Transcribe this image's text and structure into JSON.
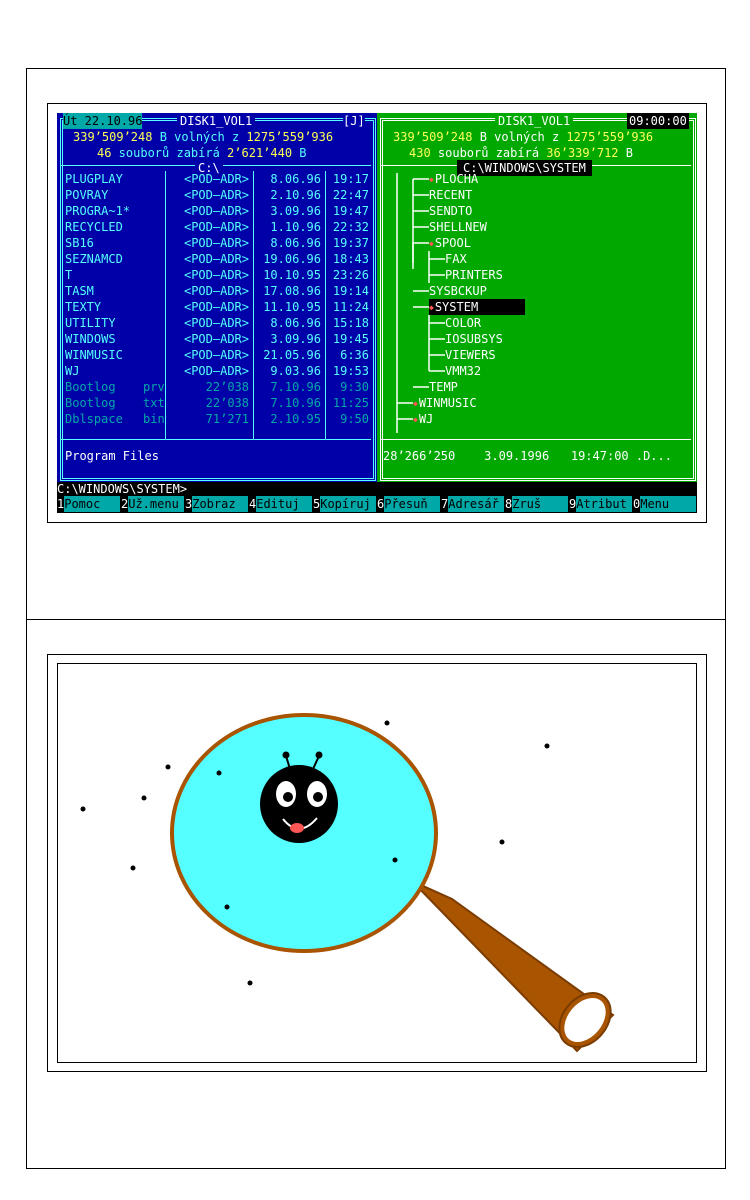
{
  "left": {
    "date": "Út 22.10.96",
    "volume": "DISK1_VOL1",
    "drive_tag": "[J]",
    "free_line": {
      "a": "339’509’248",
      "b": " B volných z ",
      "c": "1275’559’936"
    },
    "files_line": {
      "a": "46",
      "b": " souborů zabírá ",
      "c": "2’621’440",
      "d": " B"
    },
    "path": "C:\\",
    "rows": [
      {
        "name": "PLUGPLAY",
        "ext": "",
        "size": "<POD—ADR>",
        "date": "8.06.96",
        "time": "19:17"
      },
      {
        "name": "POVRAY",
        "ext": "",
        "size": "<POD—ADR>",
        "date": "2.10.96",
        "time": "22:47"
      },
      {
        "name": "PROGRA~1*",
        "ext": "",
        "size": "<POD—ADR>",
        "date": "3.09.96",
        "time": "19:47"
      },
      {
        "name": "RECYCLED",
        "ext": "",
        "size": "<POD—ADR>",
        "date": "1.10.96",
        "time": "22:32"
      },
      {
        "name": "SB16",
        "ext": "",
        "size": "<POD—ADR>",
        "date": "8.06.96",
        "time": "19:37"
      },
      {
        "name": "SEZNAMCD",
        "ext": "",
        "size": "<POD—ADR>",
        "date": "19.06.96",
        "time": "18:43"
      },
      {
        "name": "T",
        "ext": "",
        "size": "<POD—ADR>",
        "date": "10.10.95",
        "time": "23:26"
      },
      {
        "name": "TASM",
        "ext": "",
        "size": "<POD—ADR>",
        "date": "17.08.96",
        "time": "19:14"
      },
      {
        "name": "TEXTY",
        "ext": "",
        "size": "<POD—ADR>",
        "date": "11.10.95",
        "time": "11:24"
      },
      {
        "name": "UTILITY",
        "ext": "",
        "size": "<POD—ADR>",
        "date": "8.06.96",
        "time": "15:18"
      },
      {
        "name": "WINDOWS",
        "ext": "",
        "size": "<POD—ADR>",
        "date": "3.09.96",
        "time": "19:45"
      },
      {
        "name": "WINMUSIC",
        "ext": "",
        "size": "<POD—ADR>",
        "date": "21.05.96",
        "time": "6:36"
      },
      {
        "name": "WJ",
        "ext": "",
        "size": "<POD—ADR>",
        "date": "9.03.96",
        "time": "19:53"
      },
      {
        "name": "Bootlog",
        "ext": "prv",
        "size": "22’038",
        "date": "7.10.96",
        "time": "9:30"
      },
      {
        "name": "Bootlog",
        "ext": "txt",
        "size": "22’038",
        "date": "7.10.96",
        "time": "11:25"
      },
      {
        "name": "Dblspace",
        "ext": "bin",
        "size": "71’271",
        "date": "2.10.95",
        "time": "9:50"
      }
    ],
    "footer": "Program Files"
  },
  "right": {
    "volume": "DISK1_VOL1",
    "clock": "09:00:00",
    "free_line": {
      "a": "339’509’248",
      "b": " B volných z ",
      "c": "1275’559’936"
    },
    "files_line": {
      "a": "430",
      "b": " souborů zabírá ",
      "c": "36’339’712",
      "d": " B"
    },
    "path": "C:\\WINDOWS\\SYSTEM",
    "tree": [
      "PLOCHA",
      "RECENT",
      "SENDTO",
      "SHELLNEW",
      "SPOOL",
      "FAX",
      "PRINTERS",
      "SYSBCKUP",
      "SYSTEM",
      "COLOR",
      "IOSUBSYS",
      "VIEWERS",
      "VMM32",
      "TEMP",
      "WINMUSIC",
      "WJ"
    ],
    "footer": "28’266’250    3.09.1996   19:47:00 .D..."
  },
  "cmdline": "C:\\WINDOWS\\SYSTEM>",
  "fkeys": [
    {
      "n": "1",
      "l": "Pomoc"
    },
    {
      "n": "2",
      "l": "Už.menu"
    },
    {
      "n": "3",
      "l": "Zobraz"
    },
    {
      "n": "4",
      "l": "Edituj"
    },
    {
      "n": "5",
      "l": "Kopíruj"
    },
    {
      "n": "6",
      "l": "Přesuň"
    },
    {
      "n": "7",
      "l": "Adresář"
    },
    {
      "n": "8",
      "l": "Zruš"
    },
    {
      "n": "9",
      "l": "Atribut"
    },
    {
      "n": "0",
      "l": "Menu"
    }
  ],
  "colors": {
    "left_bg": "#0000a8",
    "right_bg": "#00a800",
    "lens": "#55ffff",
    "rim": "#a85400"
  },
  "bug_icon": "ladybug-face-icon",
  "magnifier_icon": "magnifying-glass-icon"
}
